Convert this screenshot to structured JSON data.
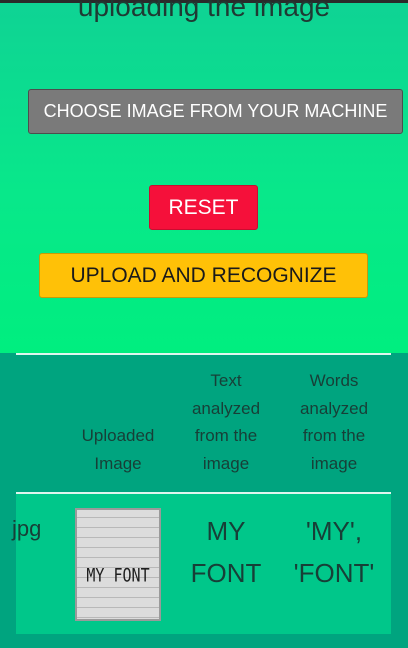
{
  "upload_panel": {
    "heading": "uploading the image",
    "choose_button": "CHOOSE IMAGE FROM YOUR MACHINE",
    "reset_button": "RESET",
    "upload_button": "UPLOAD AND RECOGNIZE"
  },
  "results_table": {
    "headers": {
      "uploaded_image": [
        "Uploaded",
        "Image"
      ],
      "text_analyzed": [
        "Text",
        "analyzed",
        "from the",
        "image"
      ],
      "words_analyzed": [
        "Words",
        "analyzed",
        "from the",
        "image"
      ]
    },
    "rows": [
      {
        "filename_fragment": "jpg",
        "thumbnail_caption": "MY FONT",
        "text": [
          "MY",
          "FONT"
        ],
        "words": [
          "'MY',",
          "'FONT'"
        ]
      }
    ]
  },
  "colors": {
    "top_gradient_start": "#0fd394",
    "top_gradient_end": "#00ee7f",
    "bottom_background": "#00a47f",
    "choose_button": "#7a7a7a",
    "reset_button": "#f5103a",
    "upload_button": "#ffc107"
  }
}
